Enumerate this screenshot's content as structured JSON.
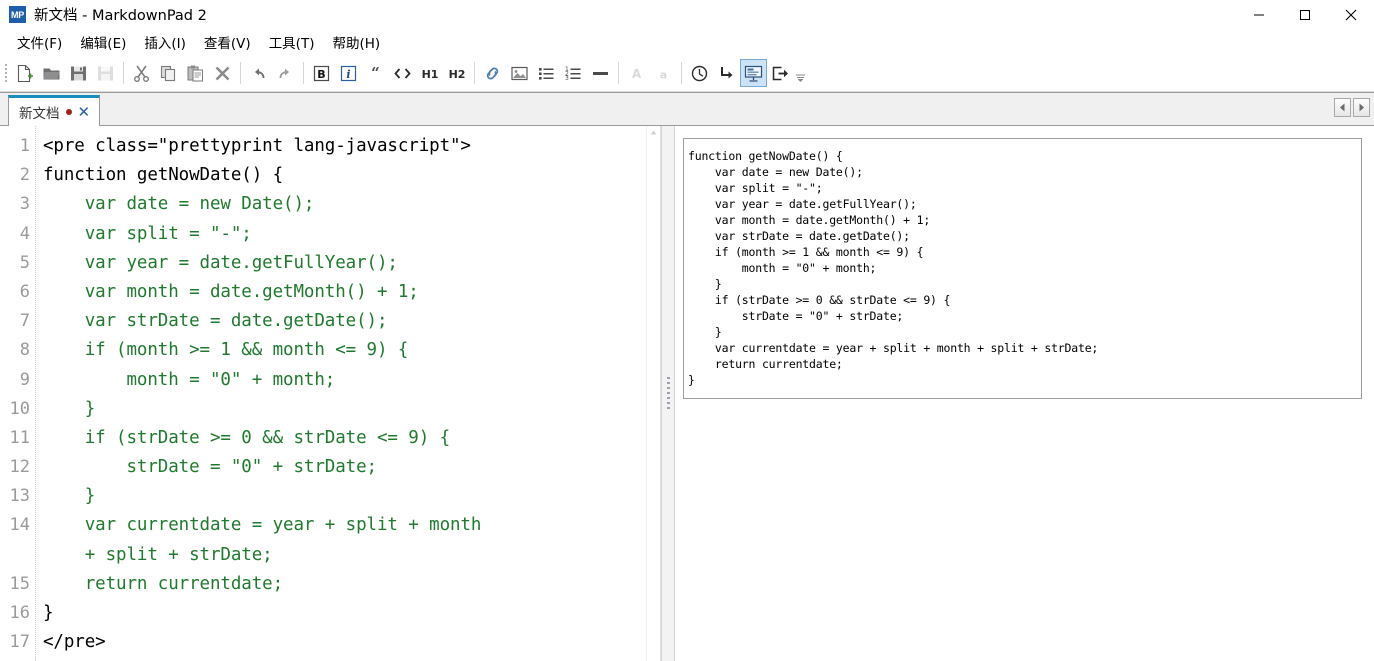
{
  "window": {
    "app_icon_text": "MP",
    "title": "新文档 - MarkdownPad 2",
    "minimize_label": "minimize",
    "maximize_label": "maximize",
    "close_label": "close"
  },
  "menubar": {
    "items": [
      {
        "label": "文件(F)",
        "name": "menu-file"
      },
      {
        "label": "编辑(E)",
        "name": "menu-edit"
      },
      {
        "label": "插入(I)",
        "name": "menu-insert"
      },
      {
        "label": "查看(V)",
        "name": "menu-view"
      },
      {
        "label": "工具(T)",
        "name": "menu-tools"
      },
      {
        "label": "帮助(H)",
        "name": "menu-help"
      }
    ]
  },
  "toolbar": {
    "items": [
      {
        "icon": "new-document-icon",
        "label": "新建",
        "state": "enabled"
      },
      {
        "icon": "open-folder-icon",
        "label": "打开",
        "state": "enabled"
      },
      {
        "icon": "save-icon",
        "label": "保存",
        "state": "enabled"
      },
      {
        "icon": "save-as-icon",
        "label": "另存为",
        "state": "disabled"
      },
      {
        "icon": "cut-icon",
        "label": "剪切",
        "state": "enabled"
      },
      {
        "icon": "copy-icon",
        "label": "复制",
        "state": "enabled"
      },
      {
        "icon": "paste-icon",
        "label": "粘贴",
        "state": "enabled"
      },
      {
        "icon": "delete-icon",
        "label": "删除",
        "state": "enabled"
      },
      {
        "icon": "undo-icon",
        "label": "撤销",
        "state": "enabled"
      },
      {
        "icon": "redo-icon",
        "label": "重做",
        "state": "enabled"
      },
      {
        "icon": "bold-icon",
        "label": "B",
        "state": "enabled"
      },
      {
        "icon": "italic-icon",
        "label": "i",
        "state": "enabled"
      },
      {
        "icon": "blockquote-icon",
        "label": "引用",
        "state": "enabled"
      },
      {
        "icon": "code-icon",
        "label": "代码",
        "state": "enabled"
      },
      {
        "icon": "heading1-icon",
        "label": "H1",
        "state": "enabled"
      },
      {
        "icon": "heading2-icon",
        "label": "H2",
        "state": "enabled"
      },
      {
        "icon": "link-icon",
        "label": "链接",
        "state": "enabled"
      },
      {
        "icon": "image-icon",
        "label": "图片",
        "state": "enabled"
      },
      {
        "icon": "bullet-list-icon",
        "label": "无序列表",
        "state": "enabled"
      },
      {
        "icon": "numbered-list-icon",
        "label": "有序列表",
        "state": "enabled"
      },
      {
        "icon": "horizontal-rule-icon",
        "label": "分隔线",
        "state": "enabled"
      },
      {
        "icon": "uppercase-a-icon",
        "label": "A",
        "state": "disabled"
      },
      {
        "icon": "lowercase-a-icon",
        "label": "a",
        "state": "disabled"
      },
      {
        "icon": "clock-icon",
        "label": "时间",
        "state": "enabled"
      },
      {
        "icon": "indent-icon",
        "label": "缩进",
        "state": "enabled"
      },
      {
        "icon": "presentation-icon",
        "label": "预览",
        "state": "active"
      },
      {
        "icon": "export-icon",
        "label": "导出",
        "state": "enabled"
      },
      {
        "icon": "overflow-chevron-icon",
        "label": "更多",
        "state": "enabled"
      }
    ]
  },
  "tabs": {
    "active_index": 0,
    "items": [
      {
        "label": "新文档",
        "modified": true,
        "close_glyph": "✕"
      }
    ],
    "scroll_left_glyph": "◀",
    "scroll_right_glyph": "▶"
  },
  "editor": {
    "lines": [
      {
        "n": "1",
        "text": "<pre class=\"prettyprint lang-javascript\">",
        "color": "black"
      },
      {
        "n": "2",
        "text": "function getNowDate() {",
        "color": "black"
      },
      {
        "n": "3",
        "text": "    var date = new Date();",
        "color": "green"
      },
      {
        "n": "4",
        "text": "    var split = \"-\";",
        "color": "green"
      },
      {
        "n": "5",
        "text": "    var year = date.getFullYear();",
        "color": "green"
      },
      {
        "n": "6",
        "text": "    var month = date.getMonth() + 1;",
        "color": "green"
      },
      {
        "n": "7",
        "text": "    var strDate = date.getDate();",
        "color": "green"
      },
      {
        "n": "8",
        "text": "    if (month >= 1 && month <= 9) {",
        "color": "green"
      },
      {
        "n": "9",
        "text": "        month = \"0\" + month;",
        "color": "green"
      },
      {
        "n": "10",
        "text": "    }",
        "color": "green"
      },
      {
        "n": "11",
        "text": "    if (strDate >= 0 && strDate <= 9) {",
        "color": "green"
      },
      {
        "n": "12",
        "text": "        strDate = \"0\" + strDate;",
        "color": "green"
      },
      {
        "n": "13",
        "text": "    }",
        "color": "green"
      },
      {
        "n": "14",
        "text": "    var currentdate = year + split + month",
        "color": "green"
      },
      {
        "n": "",
        "text": "    + split + strDate;",
        "color": "green"
      },
      {
        "n": "15",
        "text": "    return currentdate;",
        "color": "green"
      },
      {
        "n": "16",
        "text": "}",
        "color": "black"
      },
      {
        "n": "17",
        "text": "</pre>",
        "color": "black"
      }
    ]
  },
  "preview": {
    "code_lines": [
      "function getNowDate() {",
      "    var date = new Date();",
      "    var split = \"-\";",
      "    var year = date.getFullYear();",
      "    var month = date.getMonth() + 1;",
      "    var strDate = date.getDate();",
      "    if (month >= 1 && month <= 9) {",
      "        month = \"0\" + month;",
      "    }",
      "    if (strDate >= 0 && strDate <= 9) {",
      "        strDate = \"0\" + strDate;",
      "    }",
      "    var currentdate = year + split + month + split + strDate;",
      "    return currentdate;",
      "}"
    ]
  },
  "colors": {
    "accent": "#1a8fbf",
    "code_green": "#1f7a2e",
    "modified_dot": "#a02020",
    "toolbar_active": "#cce3f7",
    "app_icon_bg": "#1f5fa9"
  }
}
